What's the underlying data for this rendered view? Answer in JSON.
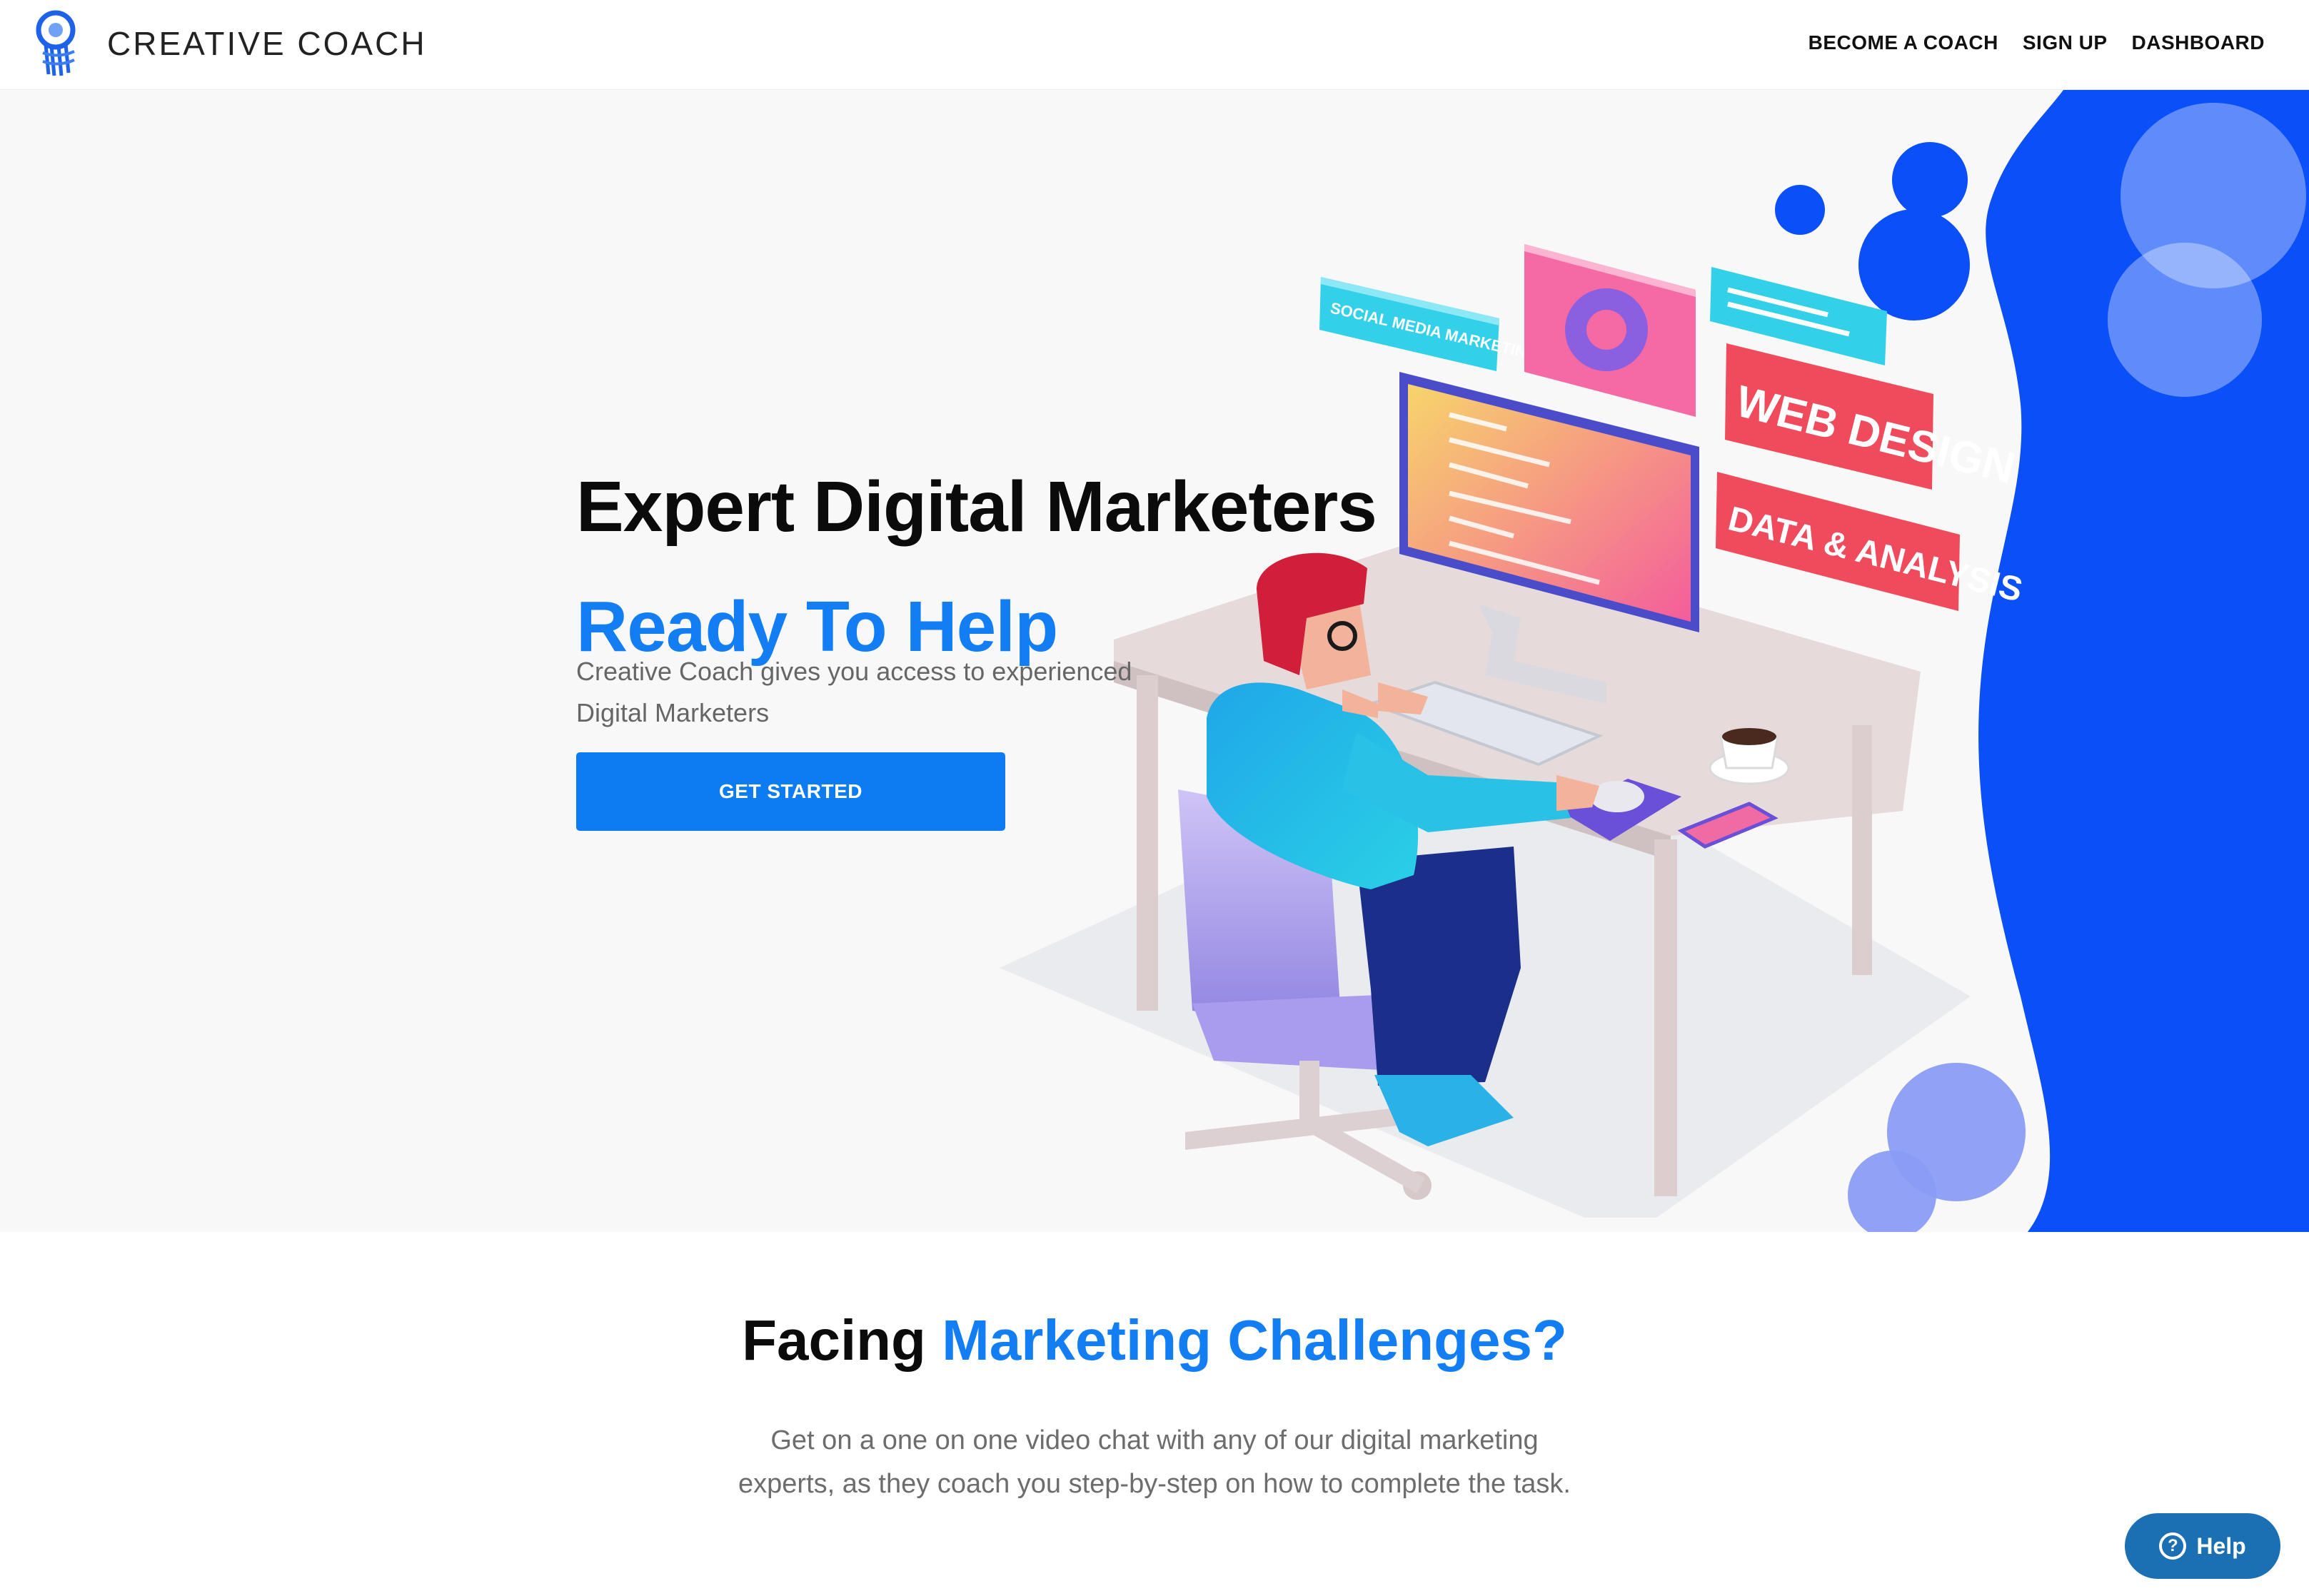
{
  "header": {
    "brand": "CREATIVE COACH",
    "nav": [
      "BECOME A COACH",
      "SIGN UP",
      "DASHBOARD"
    ]
  },
  "hero": {
    "title": "Expert Digital Marketers",
    "subtitle": "Ready To Help",
    "description": "Creative Coach gives you access to experienced Digital Marketers",
    "cta": "GET STARTED",
    "illustration_labels": {
      "social": "SOCIAL MEDIA MARKETING",
      "web": "WEB DESIGN",
      "data": "DATA & ANALYSIS"
    }
  },
  "challenges": {
    "title_dark": "Facing",
    "title_blue": "Marketing Challenges?",
    "description": "Get on a one on one video chat with any of our digital marketing experts, as they coach you step-by-step on how to complete the task."
  },
  "help": {
    "label": "Help",
    "icon_glyph": "?"
  },
  "colors": {
    "accent": "#137ef3",
    "button": "#0d7cf2",
    "blob": "#0a4ff7",
    "help": "#1b6fb3"
  }
}
